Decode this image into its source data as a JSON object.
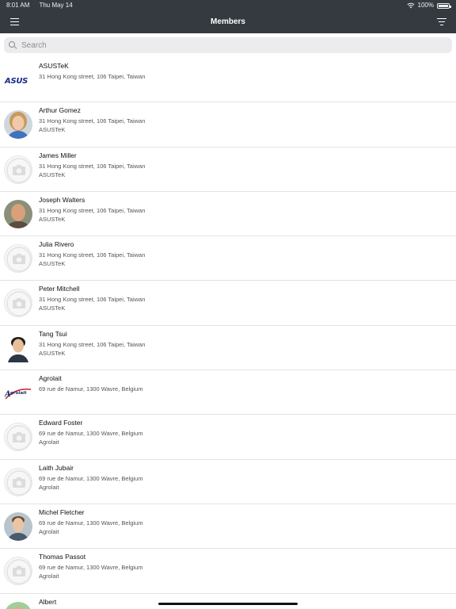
{
  "status_bar": {
    "time": "8:01 AM",
    "date": "Thu May 14",
    "battery": "100%"
  },
  "header": {
    "title": "Members"
  },
  "search": {
    "placeholder": "Search"
  },
  "members": [
    {
      "name": "ASUSTeK",
      "address": "31 Hong Kong street, 106 Taipei, Taiwan",
      "company": "",
      "avatar": "asus-logo"
    },
    {
      "name": "Arthur Gomez",
      "address": "31 Hong Kong street, 106 Taipei, Taiwan",
      "company": "ASUSTeK",
      "avatar": "photo"
    },
    {
      "name": "James Miller",
      "address": "31 Hong Kong street, 106 Taipei, Taiwan",
      "company": "ASUSTeK",
      "avatar": "placeholder"
    },
    {
      "name": "Joseph Walters",
      "address": "31 Hong Kong street, 106 Taipei, Taiwan",
      "company": "ASUSTeK",
      "avatar": "photo"
    },
    {
      "name": "Julia Rivero",
      "address": "31 Hong Kong street, 106 Taipei, Taiwan",
      "company": "ASUSTeK",
      "avatar": "placeholder"
    },
    {
      "name": "Peter Mitchell",
      "address": "31 Hong Kong street, 106 Taipei, Taiwan",
      "company": "ASUSTeK",
      "avatar": "placeholder"
    },
    {
      "name": "Tang Tsui",
      "address": "31 Hong Kong street, 106 Taipei, Taiwan",
      "company": "ASUSTeK",
      "avatar": "photo"
    },
    {
      "name": "Agrolait",
      "address": "69 rue de Namur, 1300 Wavre, Belgium",
      "company": "",
      "avatar": "agrolait-logo"
    },
    {
      "name": "Edward Foster",
      "address": "69 rue de Namur, 1300 Wavre, Belgium",
      "company": "Agrolait",
      "avatar": "placeholder"
    },
    {
      "name": "Laith Jubair",
      "address": "69 rue de Namur, 1300 Wavre, Belgium",
      "company": "Agrolait",
      "avatar": "placeholder"
    },
    {
      "name": "Michel Fletcher",
      "address": "69 rue de Namur, 1300 Wavre, Belgium",
      "company": "Agrolait",
      "avatar": "photo"
    },
    {
      "name": "Thomas Passot",
      "address": "69 rue de Namur, 1300 Wavre, Belgium",
      "company": "Agrolait",
      "avatar": "placeholder"
    },
    {
      "name": "Albert",
      "address": "",
      "company": "",
      "avatar": "photo"
    }
  ],
  "logos": {
    "asus": "ASUS",
    "agrolait": "Agrolait"
  },
  "colors": {
    "nav_background": "#343a40",
    "nav_text": "#ffffff",
    "search_background": "#ececee",
    "divider": "#e3e3e3"
  }
}
